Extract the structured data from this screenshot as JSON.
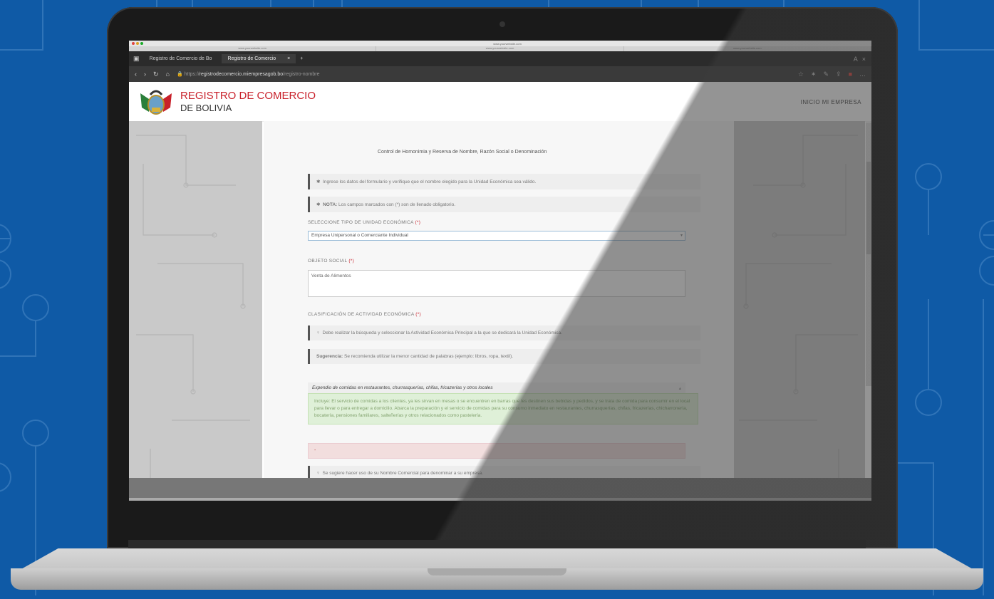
{
  "mac": {
    "url": "www.yourwebsite.com",
    "tabs": [
      "www.yourwebsite.com",
      "www.yourwebsite.com",
      "www.yourwebsite.com"
    ]
  },
  "browser": {
    "tab1": "Registro de Comercio de Bo",
    "tab2": "Registro de Comercio",
    "tab_close": "×",
    "new_tab": "+",
    "address_prefix": "https://",
    "address_domain": "registrodecomercio.miempresagob.bo",
    "address_path": "/registro-nombre"
  },
  "header": {
    "title_line1": "REGISTRO DE COMERCIO",
    "title_line2": "DE BOLIVIA",
    "link": "INICIO  MI EMPRESA"
  },
  "form": {
    "heading": "Control de Homonimia y Reserva de Nombre, Razón Social o Denominación",
    "note1": "Ingrese los datos del formulario y verifique que el nombre elegido para la Unidad Económica sea válido.",
    "note2_bold": "NOTA:",
    "note2": "Los campos marcados con (*) son de llenado obligatorio.",
    "label_tipo": "SELECCIONE TIPO DE UNIDAD ECONÓMICA",
    "req": "(*)",
    "tipo_value": "Empresa Unipersonal o Comerciante Individual",
    "label_objeto": "OBJETO SOCIAL",
    "objeto_value": "Venta de Alimentos",
    "label_clasif": "CLASIFICACIÓN DE ACTIVIDAD ECONÓMICA",
    "hint1": "Debe realizar la búsqueda y seleccionar la Actividad Económica Principal a la que se dedicará la Unidad Económica.",
    "hint2_bold": "Sugerencia:",
    "hint2": "Se recomienda utilizar la menor cantidad de palabras (ejemplo: libros, ropa, textil).",
    "actividad_value": "Expendio de comidas en restaurantes, churrasquerías, chifas, fricazerías y otros locales",
    "green_text": "Incluye: El servicio de comidas a los clientes, ya les sirvan en mesas o se encuentren en barras que les destinen sus bebidas y pedidos, y se trata de comida para consumir en el local para llevar o para entregar a domicilio. Abarca la preparación y el servicio de comidas para su consumo inmediato en restaurantes, churrasquerías, chifas, fricazerías, chicharronería, bocatería, pensiones familiares, salteñerías y otros relacionados como pastelería.",
    "pink_text": "-",
    "hint3": "Se sugiere hacer uso de su Nombre Comercial para denominar a su empresa."
  },
  "colors": {
    "brand_red": "#c8202a",
    "background": "#0f5aa6"
  }
}
